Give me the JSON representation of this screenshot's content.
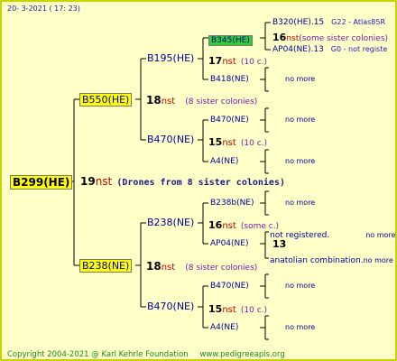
{
  "date": "20-  3-2021 ( 17: 23)",
  "root": {
    "name": "B299(HE)",
    "count": "19",
    "unit": "nst",
    "note": "(Drones from 8 sister colonies)"
  },
  "gen1": [
    {
      "name": "B550(HE)",
      "count": "18",
      "unit": "nst",
      "note": "(8 sister colonies)"
    },
    {
      "name": "B238(NE)",
      "count": "18",
      "unit": "nst",
      "note": "(8 sister colonies)"
    }
  ],
  "gen2": [
    {
      "name": "B195(HE)",
      "count": "17",
      "unit": "nst",
      "note": "(10 c.)"
    },
    {
      "name": "B470(NE)",
      "count": "15",
      "unit": "nst",
      "note": "(10 c.)"
    },
    {
      "name": "B238(NE)",
      "count": "16",
      "unit": "nst",
      "note": "(some c.)"
    },
    {
      "name": "B470(NE)",
      "count": "15",
      "unit": "nst",
      "note": "(10 c.)"
    }
  ],
  "gen3": [
    "B345(HE)",
    "B418(NE)",
    "B470(NE)",
    "A4(NE)",
    "B238b(NE)",
    "AP04(NE)",
    "B470(NE)",
    "A4(NE)"
  ],
  "gen4_b345": {
    "father": "B320(HE).15",
    "father_extra": "G22 - Atlas85R",
    "count": "16",
    "unit": "nst",
    "note": "(some sister colonies)",
    "mother": "AP04(NE).13",
    "mother_extra": "G0 - not registe"
  },
  "gen4_ap04": {
    "father": "not registered.",
    "count": "13",
    "mother": "anatolian combination.",
    "mother_extra": "no more"
  },
  "labels": {
    "no_more": "no more"
  },
  "footer": {
    "copyright": "Copyright 2004-2021 @ Karl Kehrle Foundation",
    "url": "www.pedigreeapis.org"
  }
}
